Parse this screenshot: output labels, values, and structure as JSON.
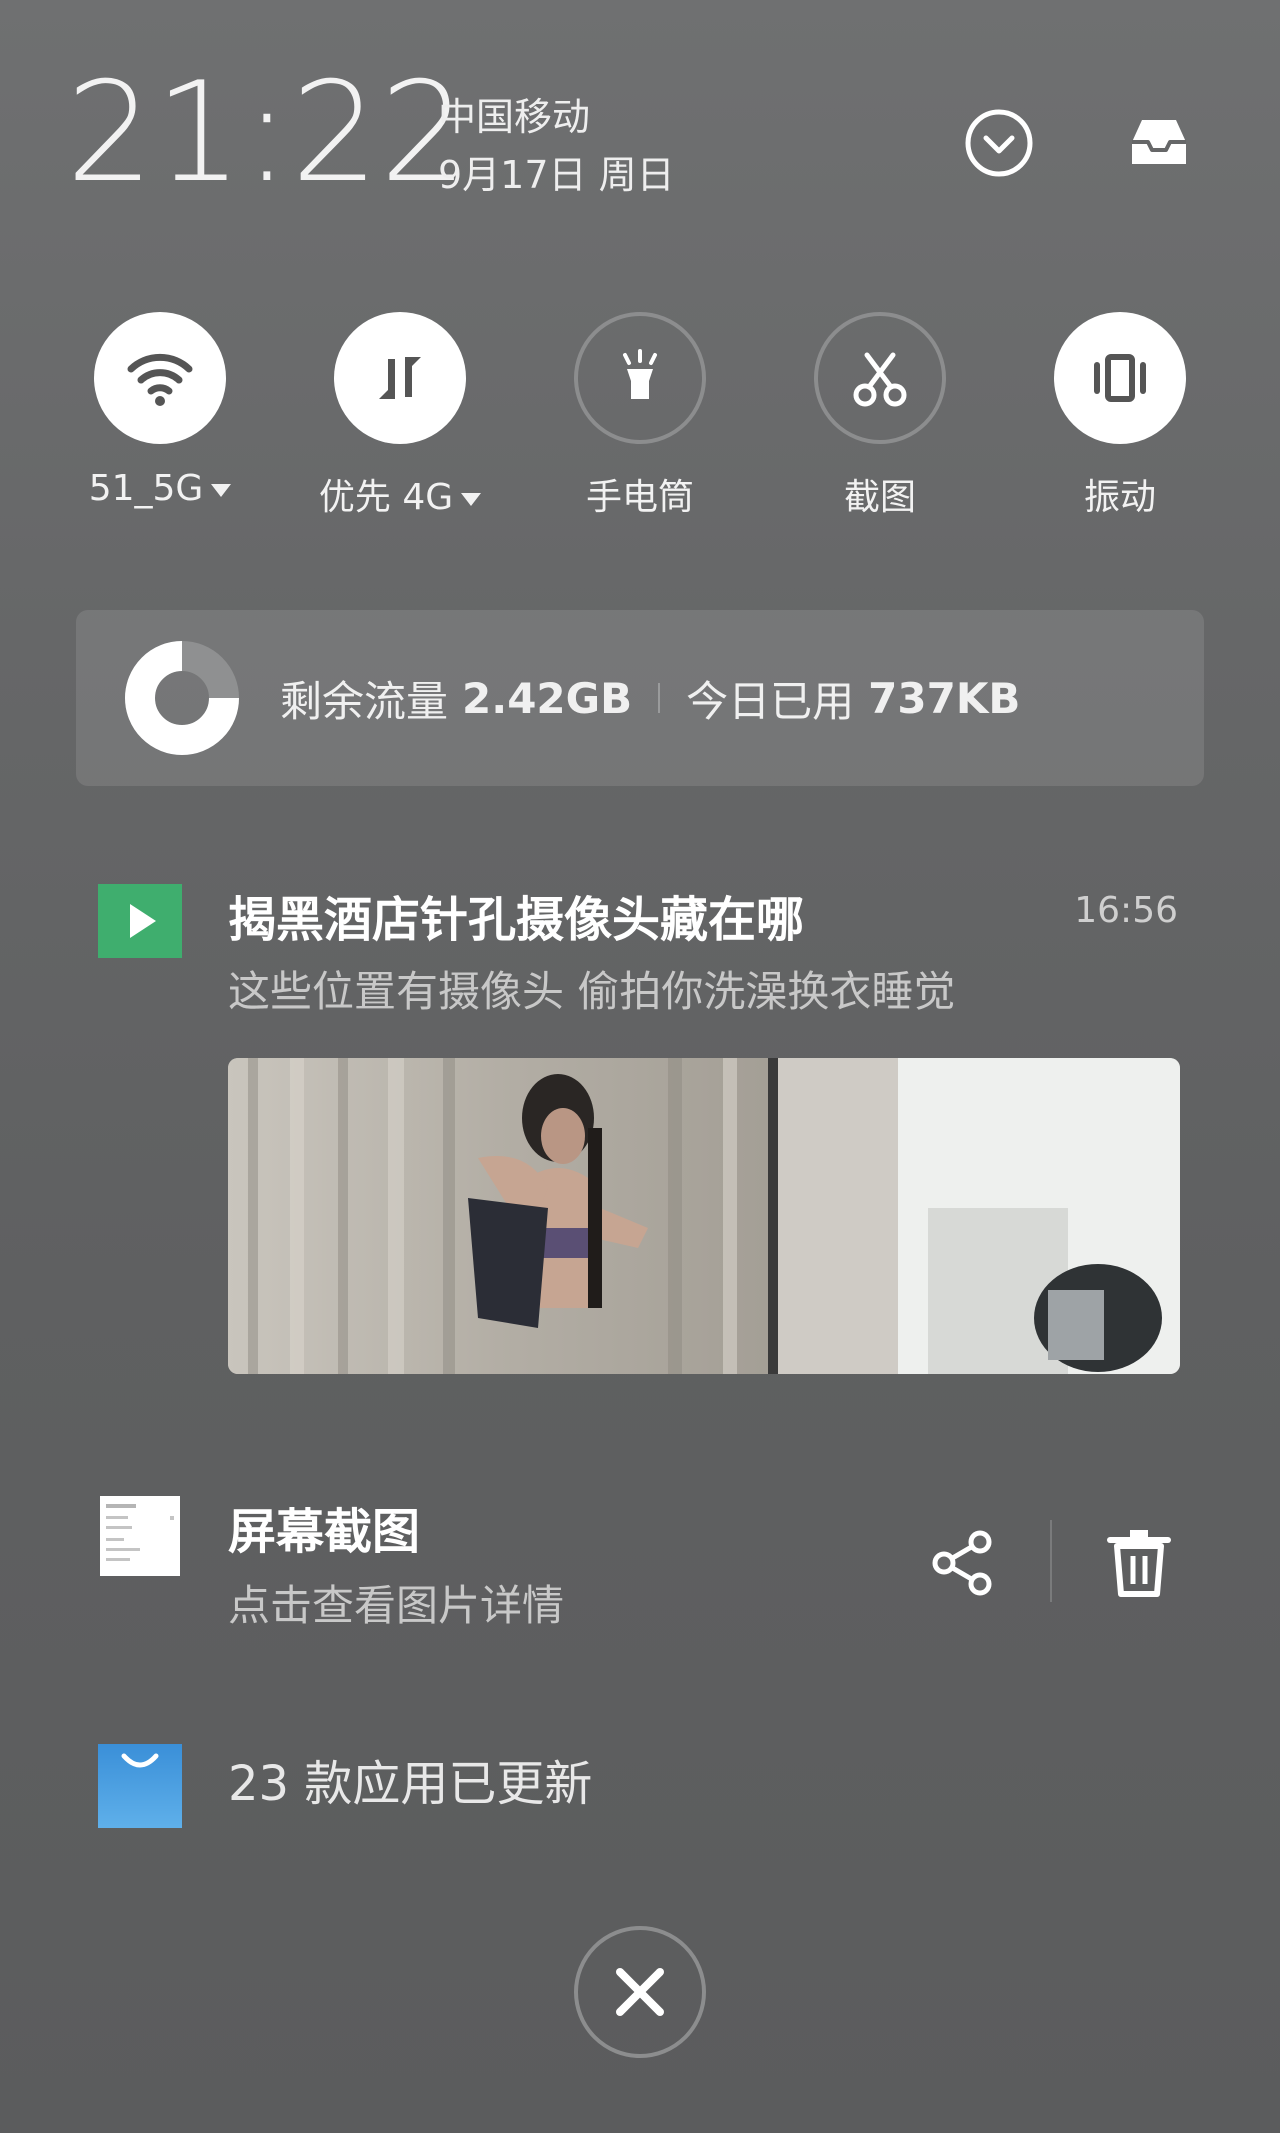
{
  "status": {
    "time": "21:22",
    "carrier": "中国移动",
    "date": "9月17日 周日"
  },
  "header_icons": [
    "chevron-down-circle-icon",
    "inbox-icon"
  ],
  "toggles": [
    {
      "label": "51_5G",
      "icon": "wifi-icon",
      "state": "on",
      "has_dropdown": true
    },
    {
      "label": "优先 4G",
      "icon": "mobile-data-icon",
      "state": "on",
      "has_dropdown": true
    },
    {
      "label": "手电筒",
      "icon": "flashlight-icon",
      "state": "off",
      "has_dropdown": false
    },
    {
      "label": "截图",
      "icon": "scissors-icon",
      "state": "off",
      "has_dropdown": false
    },
    {
      "label": "振动",
      "icon": "vibrate-icon",
      "state": "on",
      "has_dropdown": false
    }
  ],
  "data_usage": {
    "remaining_label": "剩余流量",
    "remaining_value": "2.42GB",
    "used_label": "今日已用",
    "used_value": "737KB"
  },
  "notifications": [
    {
      "app_icon": "video-play-icon",
      "title": "揭黑酒店针孔摄像头藏在哪",
      "subtitle": "这些位置有摄像头 偷拍你洗澡换衣睡觉",
      "time": "16:56",
      "has_image": true
    },
    {
      "app_icon": "screenshot-thumbnail-icon",
      "title": "屏幕截图",
      "subtitle": "点击查看图片详情",
      "actions": [
        "share-icon",
        "trash-icon"
      ]
    },
    {
      "app_icon": "app-store-icon",
      "title": "23 款应用已更新"
    }
  ],
  "colors": {
    "background": "#666768",
    "toggle_on": "#ffffff",
    "toggle_off_border": "#8c8d8e",
    "video_icon_green": "#3fae6e",
    "store_icon_blue": "#3a8fd8"
  }
}
